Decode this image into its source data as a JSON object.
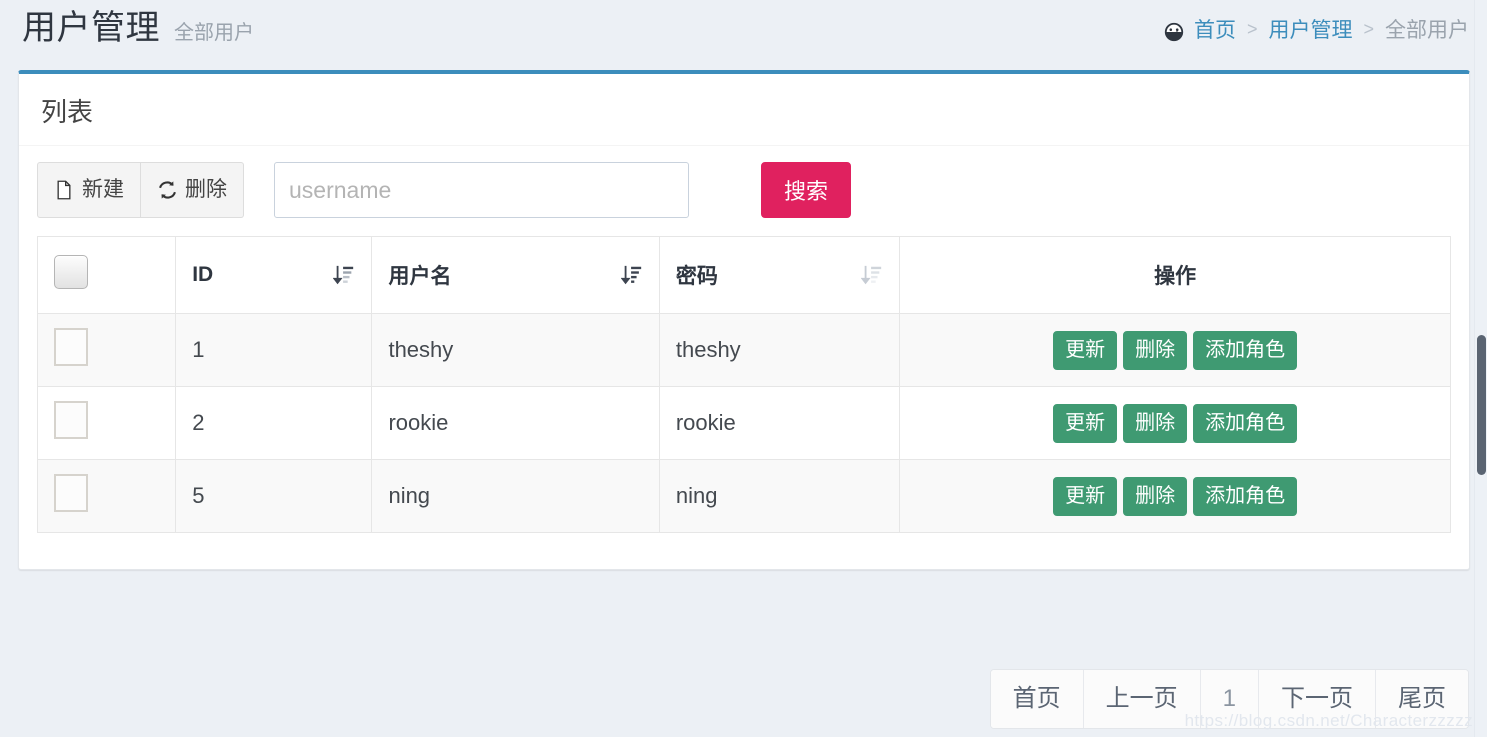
{
  "header": {
    "title": "用户管理",
    "subtitle": "全部用户",
    "breadcrumb": {
      "home_icon": "dashboard-icon",
      "items": [
        {
          "label": "首页",
          "active": false
        },
        {
          "label": "用户管理",
          "active": false
        },
        {
          "label": "全部用户",
          "active": true
        }
      ],
      "separator": ">"
    }
  },
  "box": {
    "title": "列表"
  },
  "toolbar": {
    "new_label": "新建",
    "new_icon": "file-icon",
    "delete_label": "删除",
    "delete_icon": "refresh-icon",
    "search_placeholder": "username",
    "search_value": "",
    "search_button_label": "搜索",
    "search_button_color": "#e0215f"
  },
  "table": {
    "select_all_checked": false,
    "columns": [
      {
        "key": "check",
        "label": "",
        "sort_icon": null
      },
      {
        "key": "id",
        "label": "ID",
        "sort_icon": "sort-amount-down-icon",
        "sort_state": "active"
      },
      {
        "key": "username",
        "label": "用户名",
        "sort_icon": "sort-amount-desc-icon",
        "sort_state": "active"
      },
      {
        "key": "password",
        "label": "密码",
        "sort_icon": "sort-amount-down-icon",
        "sort_state": "inactive"
      },
      {
        "key": "operation",
        "label": "操作",
        "sort_icon": null
      }
    ],
    "rows": [
      {
        "checked": false,
        "id": "1",
        "username": "theshy",
        "password": "theshy"
      },
      {
        "checked": false,
        "id": "2",
        "username": "rookie",
        "password": "rookie"
      },
      {
        "checked": false,
        "id": "5",
        "username": "ning",
        "password": "ning"
      }
    ],
    "row_actions": [
      {
        "label": "更新",
        "color": "#3f9a72"
      },
      {
        "label": "删除",
        "color": "#3f9a72"
      },
      {
        "label": "添加角色",
        "color": "#3f9a72"
      }
    ]
  },
  "pagination": {
    "first": "首页",
    "prev": "上一页",
    "current": "1",
    "next": "下一页",
    "last": "尾页"
  },
  "watermark": "https://blog.csdn.net/Characterzzzzz",
  "theme": {
    "page_background": "#ecf0f5",
    "box_accent": "#3c8dbc",
    "link": "#3c8dbc",
    "action_green": "#3f9a72",
    "search_pink": "#e0215f"
  }
}
